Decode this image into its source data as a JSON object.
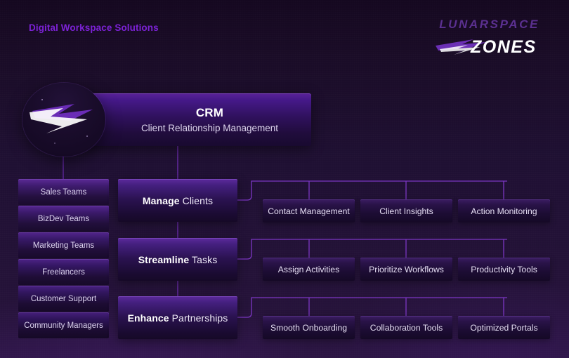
{
  "header": {
    "kicker": "Digital Workspace Solutions",
    "brand_word": "LUNARSPACE",
    "brand_mark": "ZONES",
    "brand_mark_icon": "lightning-bolt-icon"
  },
  "colors": {
    "background": "#1f1033",
    "accent_purple": "#7c22d6",
    "connector": "#8b3ddb",
    "node_highlight": "#5c2a9c",
    "text_primary": "#ffffff",
    "text_secondary": "#ded5ee"
  },
  "root": {
    "logo_icon": "lightning-bolt-badge-icon",
    "title": "CRM",
    "subtitle": "Client Relationship Management"
  },
  "sidebar": {
    "items": [
      {
        "label": "Sales Teams"
      },
      {
        "label": "BizDev Teams"
      },
      {
        "label": "Marketing Teams"
      },
      {
        "label": "Freelancers"
      },
      {
        "label": "Customer Support"
      },
      {
        "label": "Community Managers"
      }
    ]
  },
  "branches": [
    {
      "bold": "Manage",
      "rest": " Clients",
      "leaves": [
        "Contact Management",
        "Client Insights",
        "Action Monitoring"
      ]
    },
    {
      "bold": "Streamline",
      "rest": " Tasks",
      "leaves": [
        "Assign Activities",
        "Prioritize Workflows",
        "Productivity Tools"
      ]
    },
    {
      "bold": "Enhance",
      "rest": " Partnerships",
      "leaves": [
        "Smooth Onboarding",
        "Collaboration Tools",
        "Optimized Portals"
      ]
    }
  ]
}
